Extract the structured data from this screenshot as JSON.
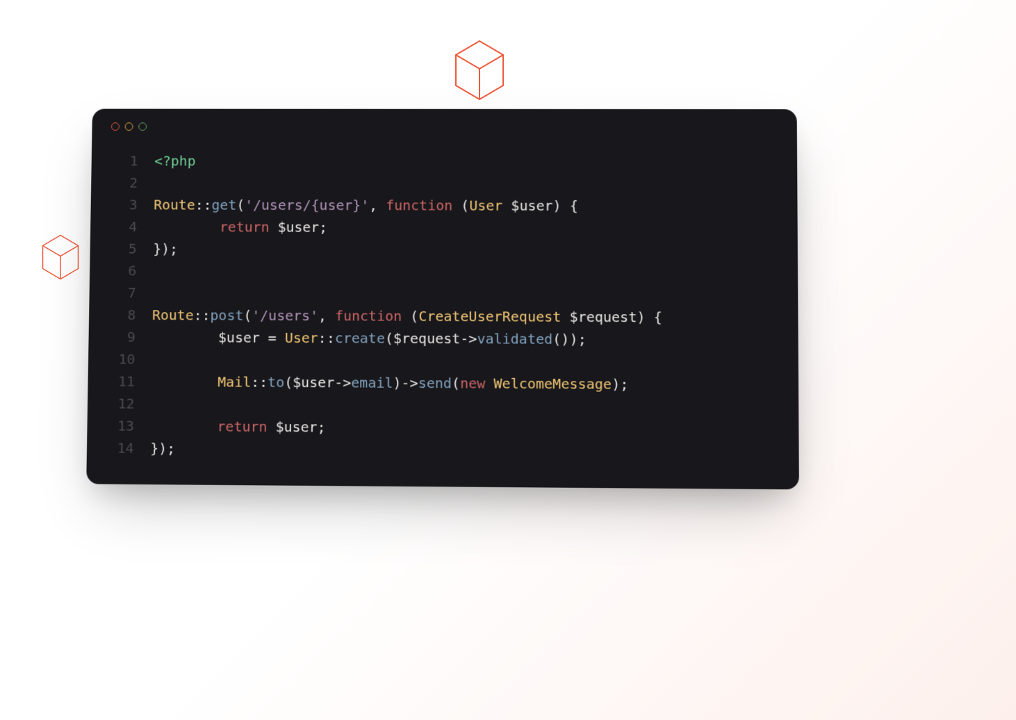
{
  "decor": {
    "cube_top": "cube-icon",
    "cube_left": "cube-icon"
  },
  "window": {
    "dot_red": "close",
    "dot_yellow": "minimize",
    "dot_green": "maximize"
  },
  "code": {
    "line_numbers": [
      "1",
      "2",
      "3",
      "4",
      "5",
      "6",
      "7",
      "8",
      "9",
      "10",
      "11",
      "12",
      "13",
      "14"
    ],
    "lines": {
      "l1": {
        "php_open": "<?php"
      },
      "l2": {
        "blank": ""
      },
      "l3": {
        "cls": "Route",
        "dcolon": "::",
        "method": "get",
        "open_paren": "(",
        "str": "'/users/{user}'",
        "comma": ", ",
        "fn": "function ",
        "open_fn_paren": "(",
        "type": "User ",
        "var": "$user",
        "close_fn_paren": ")",
        "sp_brace": " {"
      },
      "l4": {
        "indent": "        ",
        "ret": "return ",
        "var": "$user",
        "semi": ";"
      },
      "l5": {
        "close": "});"
      },
      "l6": {
        "blank": ""
      },
      "l7": {
        "blank": ""
      },
      "l8": {
        "cls": "Route",
        "dcolon": "::",
        "method": "post",
        "open_paren": "(",
        "str": "'/users'",
        "comma": ", ",
        "fn": "function ",
        "open_fn_paren": "(",
        "type": "CreateUserRequest ",
        "var": "$request",
        "close_fn_paren": ")",
        "sp_brace": " {"
      },
      "l9": {
        "indent": "        ",
        "var1": "$user",
        "eq": " = ",
        "cls": "User",
        "dcolon": "::",
        "method": "create",
        "open_paren": "(",
        "var2": "$request",
        "arrow": "->",
        "method2": "validated",
        "parens2": "()",
        "close": ");"
      },
      "l10": {
        "blank": ""
      },
      "l11": {
        "indent": "        ",
        "cls": "Mail",
        "dcolon": "::",
        "method": "to",
        "open_paren": "(",
        "var": "$user",
        "arrow": "->",
        "prop": "email",
        "close_paren": ")",
        "arrow2": "->",
        "method2": "send",
        "open_paren2": "(",
        "nkw": "new ",
        "cls2": "WelcomeMessage",
        "close": ");"
      },
      "l12": {
        "blank": ""
      },
      "l13": {
        "indent": "        ",
        "ret": "return ",
        "var": "$user",
        "semi": ";"
      },
      "l14": {
        "close": "});"
      }
    }
  },
  "colors": {
    "accent_orange": "#ef5a3c",
    "card_bg": "#18171b",
    "tag": "#6fcf97",
    "class": "#f0c674",
    "method": "#81a2be",
    "string": "#b294bb",
    "keyword": "#cc6666",
    "text": "#e8e6e3",
    "line_number": "#4a4a52"
  }
}
